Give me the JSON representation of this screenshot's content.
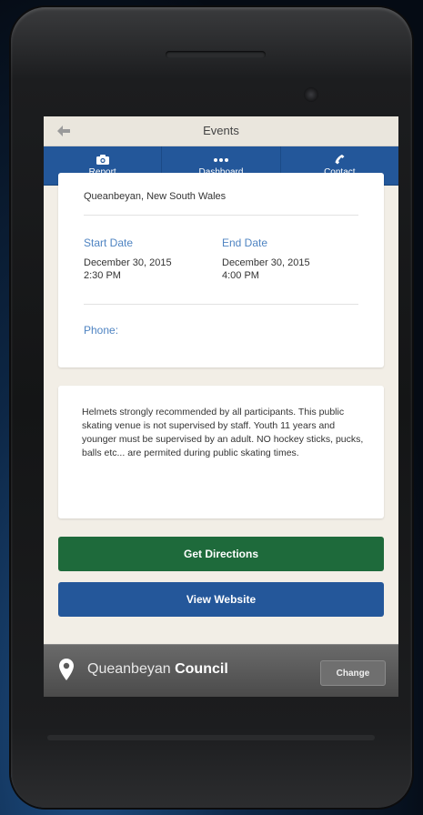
{
  "header": {
    "title": "Events"
  },
  "tabs": [
    {
      "label": "Report",
      "icon": "camera-icon"
    },
    {
      "label": "Dashboard",
      "icon": "dots-icon"
    },
    {
      "label": "Contact",
      "icon": "phone-icon"
    }
  ],
  "details": {
    "location": "Queanbeyan, New South Wales",
    "start_label": "Start Date",
    "start_date": "December 30, 2015",
    "start_time": "2:30 PM",
    "end_label": "End Date",
    "end_date": "December 30, 2015",
    "end_time": "4:00 PM",
    "phone_label": "Phone:"
  },
  "description": "Helmets strongly recommended by all participants. This public skating venue is not supervised by staff. Youth 11 years and younger must be supervised by an adult. NO hockey sticks, pucks, balls etc... are permited during public skating times.",
  "actions": {
    "directions": "Get Directions",
    "website": "View Website"
  },
  "footer": {
    "council_prefix": "Queanbeyan",
    "council_suffix": "Council",
    "change_label": "Change"
  },
  "colors": {
    "tab_bar": "#23579a",
    "directions_button": "#1e6a3b",
    "website_button": "#24579a",
    "label_blue": "#4f84c2"
  }
}
